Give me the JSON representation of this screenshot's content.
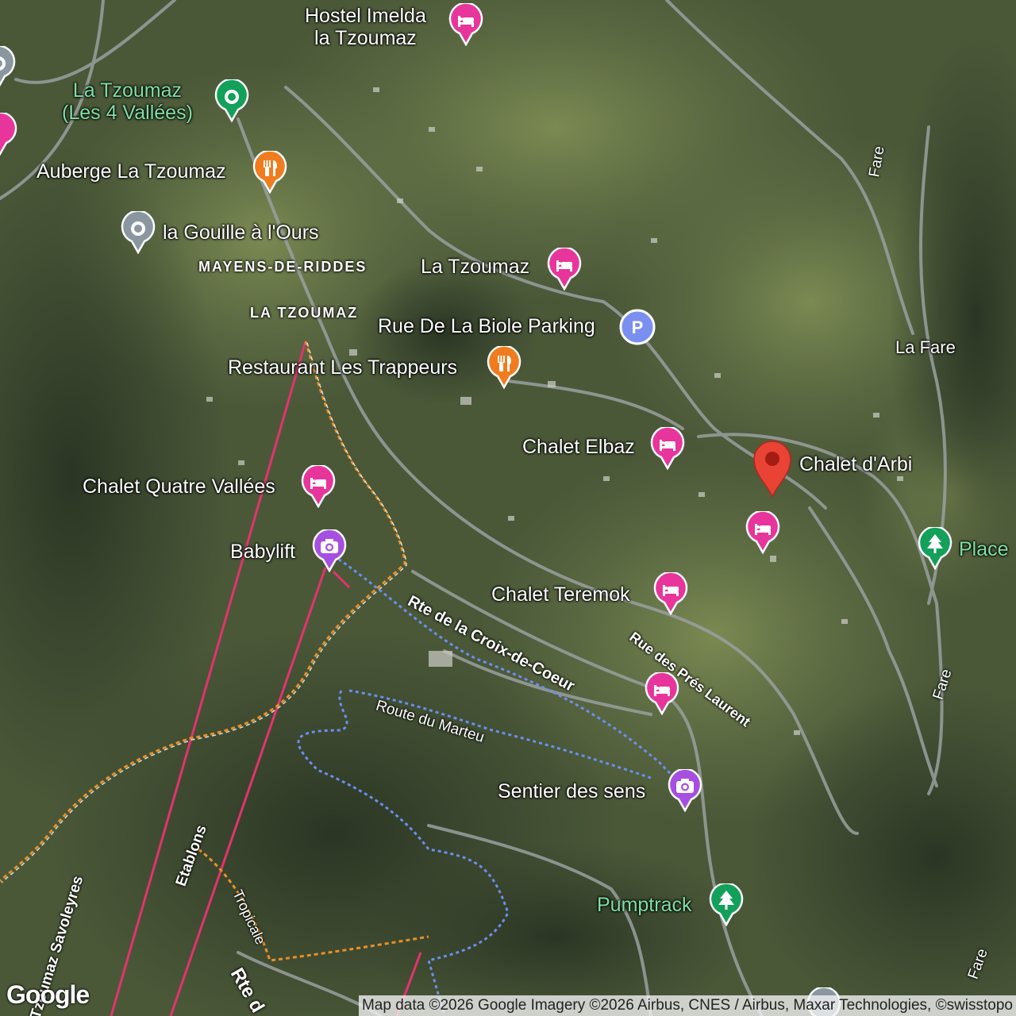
{
  "places": {
    "hostel_imelda": "Hostel Imelda\nla Tzoumaz",
    "la_tzoumaz_4v": "La Tzoumaz\n(Les 4 Vallées)",
    "auberge": "Auberge La Tzoumaz",
    "gouille": "la Gouille à l'Ours",
    "la_tzoumaz_hotel": "La Tzoumaz",
    "parking": "Rue De La Biole Parking",
    "trappeurs": "Restaurant Les Trappeurs",
    "chalet_elbaz": "Chalet Elbaz",
    "chalet_arbi": "Chalet d'Arbi",
    "chalet_quatre": "Chalet Quatre Vallées",
    "babylift": "Babylift",
    "chalet_teremok": "Chalet Teremok",
    "sentier": "Sentier des sens",
    "pumptrack": "Pumptrack",
    "place": "Place",
    "la_fare": "La Fare"
  },
  "areas": {
    "mayens": "MAYENS-DE-RIDDES",
    "tzoumaz": "LA TZOUMAZ"
  },
  "roads": {
    "croix": "Rte de la Croix-de-Coeur",
    "pres_laurent": "Rue des Prés Laurent",
    "marteu": "Route du Marteu",
    "etablons": "Etablons",
    "savoleyres": "Tzoumaz Savoleyres",
    "tropicale": "Tropicale",
    "rte_c": "Rte d",
    "fare1": "Fare",
    "fare2": "Fare",
    "fare3": "Fare"
  },
  "attribution": "Map data ©2026 Google Imagery ©2026 Airbus, CNES / Airbus, Maxar Technologies, ©swisstopo",
  "logo": "Google",
  "colors": {
    "hotel": "#e8359b",
    "restaurant": "#f07c1f",
    "parking": "#7a8ff0",
    "attraction": "#a64fe0",
    "park": "#12a05a",
    "transit": "#12a05a",
    "gray": "#8a97a1",
    "selected": "#e94335"
  },
  "icons": {
    "hotel": "bed-icon",
    "restaurant": "fork-knife-icon",
    "parking": "parking-icon",
    "attraction": "camera-icon",
    "park": "tree-icon",
    "transit": "location-dot-icon"
  }
}
